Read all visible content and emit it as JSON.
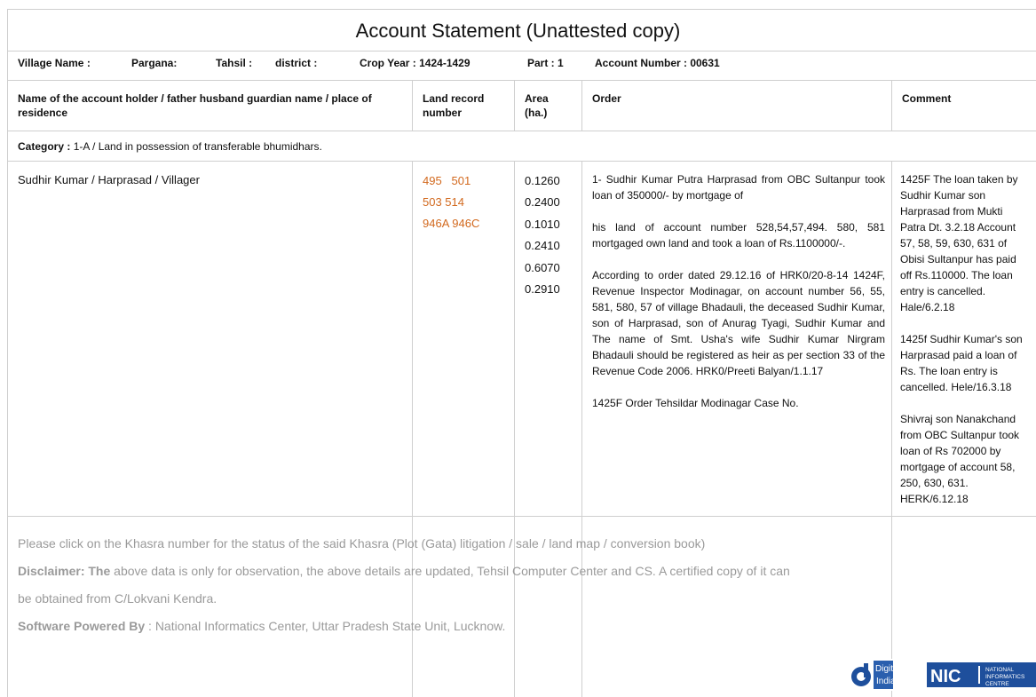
{
  "title": "Account Statement (Unattested copy)",
  "meta": {
    "village": "Village Name :",
    "pargana": "Pargana:",
    "tahsil": "Tahsil :",
    "district": "district :",
    "crop_year": "Crop Year : 1424-1429",
    "part": "Part : 1",
    "account": "Account Number : 00631"
  },
  "columns": {
    "holder": "Name of the account holder / father husband guardian name / place of residence",
    "record": "Land record number",
    "area": "Area (ha.)",
    "order": "Order",
    "comment": "Comment"
  },
  "category": {
    "label": "Category :",
    "value": "1-A / Land in possession of transferable bhumidhars."
  },
  "row": {
    "holder": "Sudhir Kumar / Harprasad / Villager",
    "records": [
      "495   501",
      "503 514",
      "946A 946C"
    ],
    "areas": [
      "0.1260",
      "0.2400",
      "0.1010",
      "0.2410",
      "0.6070",
      "0.2910"
    ],
    "orders": [
      "1- Sudhir Kumar Putra Harprasad from OBC Sultanpur took loan of 350000/- by mortgage of",
      "his land of account number 528,54,57,494. 580, 581 mortgaged own land and took a loan of Rs.1100000/-.",
      "According to order dated 29.12.16 of HRK0/20-8-14 1424F, Revenue Inspector Modinagar, on account number 56, 55, 581, 580, 57 of village Bhadauli, the deceased Sudhir Kumar, son of Harprasad, son of Anurag Tyagi, Sudhir Kumar and The name of Smt. Usha's wife Sudhir Kumar Nirgram Bhadauli should be registered as heir as per section 33 of the Revenue Code 2006. HRK0/Preeti Balyan/1.1.17",
      "1425F Order Tehsildar Modinagar Case No."
    ],
    "comments": [
      "1425F The loan taken by Sudhir Kumar son Harprasad from Mukti Patra Dt. 3.2.18 Account 57, 58, 59, 630, 631 of Obisi Sultanpur has paid off Rs.110000. The loan entry is cancelled. Hale/6.2.18",
      "1425f Sudhir Kumar's son Harprasad paid a loan of Rs. The loan entry is cancelled. Hele/16.3.18",
      "Shivraj son Nanakchand from OBC Sultanpur took loan of Rs 702000 by mortgage of account 58, 250, 630, 631. HERK/6.12.18"
    ]
  },
  "footer": {
    "click_note": "Please click on the Khasra number for the status of the said Khasra (Plot (Gata) litigation / sale / land map / conversion book)",
    "disclaimer_label": "Disclaimer: The",
    "disclaimer_text": " above data is only for observation, the above details are updated, Tehsil Computer Center and CS. A certified copy of it can",
    "disclaimer_cont": "be obtained from C/Lokvani Kendra.",
    "powered_label": "Software Powered By",
    "powered_text": " : National Informatics Center, Uttar Pradesh State Unit, Lucknow."
  },
  "logos": {
    "digital_india_line1": "Digital",
    "digital_india_line2": "India",
    "nic": "NIC",
    "nic_sub1": "NATIONAL",
    "nic_sub2": "INFORMATICS",
    "nic_sub3": "CENTRE"
  },
  "colors": {
    "record_link": "#d2691e",
    "footer_text": "#9a9a9a",
    "nic_blue": "#1e4f9c"
  }
}
